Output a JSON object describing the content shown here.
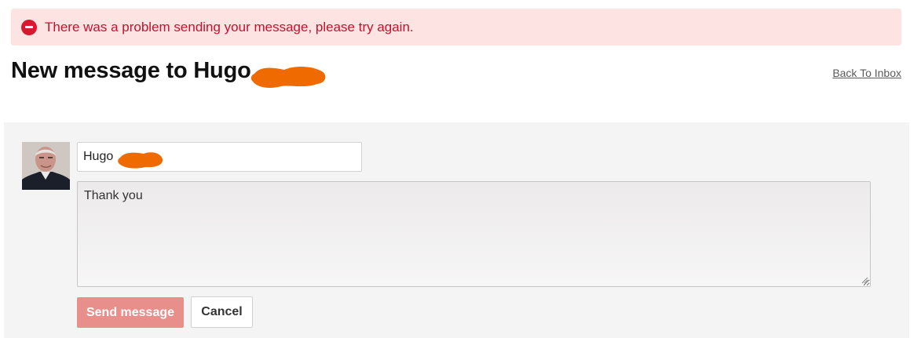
{
  "alert": {
    "icon": "error-minus-circle-icon",
    "text": "There was a problem sending your message, please try again.",
    "color": "#c8102e",
    "background": "#fde4e2"
  },
  "header": {
    "title": "New message to Hugo",
    "back_link": "Back To Inbox"
  },
  "compose": {
    "recipient_value": "Hugo",
    "message_value": "Thank you",
    "send_label": "Send message",
    "cancel_label": "Cancel",
    "send_color": "#e98f8b",
    "redaction_color": "#ef6a00"
  }
}
